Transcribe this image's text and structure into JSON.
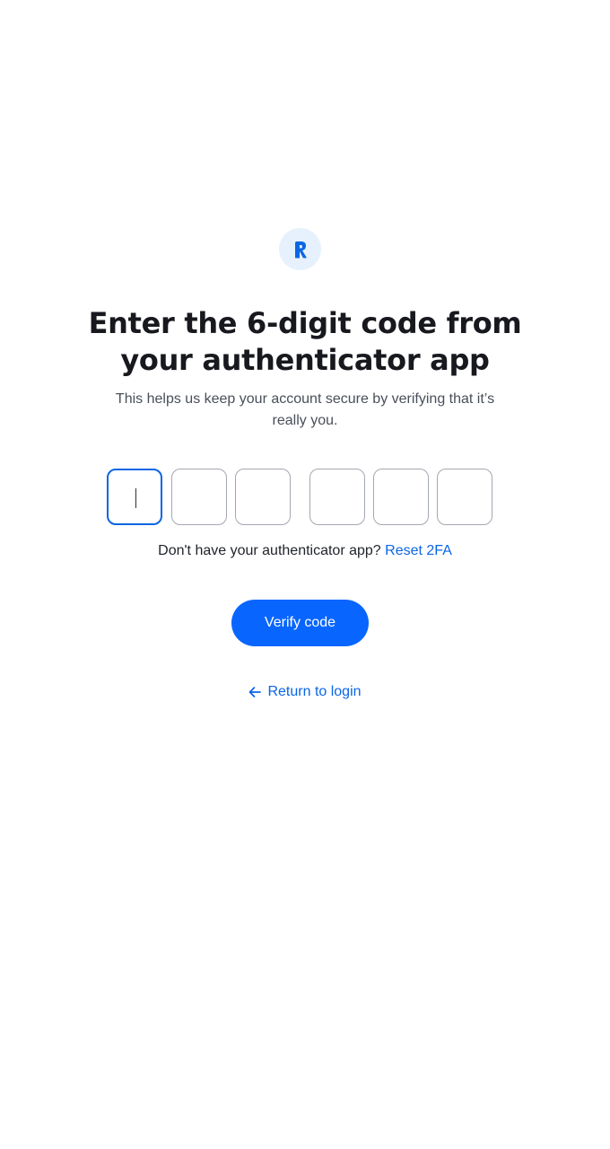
{
  "logo": {
    "icon": "brand-r-logo",
    "letter": "R",
    "accent": "#0b66e4",
    "background": "#e6f1fd"
  },
  "heading": {
    "line1": "Enter the 6-digit code from",
    "line2": "your authenticator app"
  },
  "subtitle": {
    "line1": "This helps us keep your account secure by verifying that it’s",
    "line2": "really you."
  },
  "code_inputs": {
    "count": 6,
    "values": [
      "",
      "",
      "",
      "",
      "",
      ""
    ],
    "active_index": 0
  },
  "hint": {
    "text": "Don't have your authenticator app?",
    "link_label": "Reset 2FA"
  },
  "verify_button": {
    "label": "Verify code",
    "color": "#0866ff"
  },
  "return_link": {
    "icon": "arrow-left-icon",
    "label": "Return to login"
  }
}
